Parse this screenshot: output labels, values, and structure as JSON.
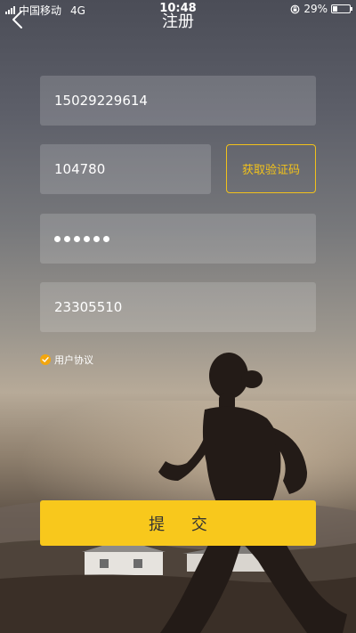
{
  "status_bar": {
    "carrier": "中国移动",
    "network": "4G",
    "time": "10:48",
    "battery_percent": "29%",
    "battery_level": 0.29
  },
  "nav": {
    "title": "注册",
    "back_icon": "chevron-left-icon"
  },
  "form": {
    "phone_value": "15029229614",
    "code_value": "104780",
    "get_code_label": "获取验证码",
    "password_dot_count": 6,
    "invite_value": "23305510",
    "agreement_label": "用户协议",
    "submit_label": "提 交"
  },
  "colors": {
    "accent": "#f8c81c",
    "code_button_border": "#f2c21b",
    "check": "#f2a60f"
  }
}
